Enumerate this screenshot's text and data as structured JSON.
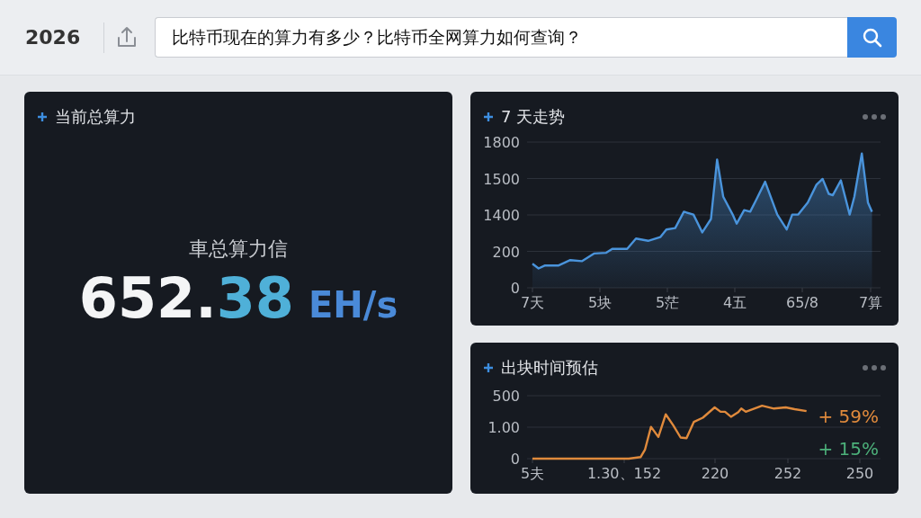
{
  "header": {
    "year": "2026",
    "search": {
      "value": "比特币现在的算力有多少？比特币全网算力如何查询？"
    }
  },
  "hashrate_card": {
    "title": "当前总算力",
    "subtitle": "車总算力信",
    "value": "652.38",
    "unit": "EH/s"
  },
  "trend_card": {
    "title": "7 天走势",
    "y_axis_labels": [
      "1800",
      "1500",
      "1400",
      "200",
      "0"
    ],
    "x_axis_labels": [
      "7天",
      "5块",
      "5茫",
      "4五",
      "65/8",
      "7算"
    ]
  },
  "block_card": {
    "title": "出块时间预估",
    "y_axis_labels": [
      "500",
      "1.00",
      "0"
    ],
    "x_axis_labels": [
      "5夫",
      "1.30、152",
      "220",
      "252",
      "250"
    ],
    "changes": [
      {
        "text": "+ 59%",
        "color": "#e08a3c"
      },
      {
        "text": "+ 15%",
        "color": "#4cb07a"
      }
    ]
  }
}
